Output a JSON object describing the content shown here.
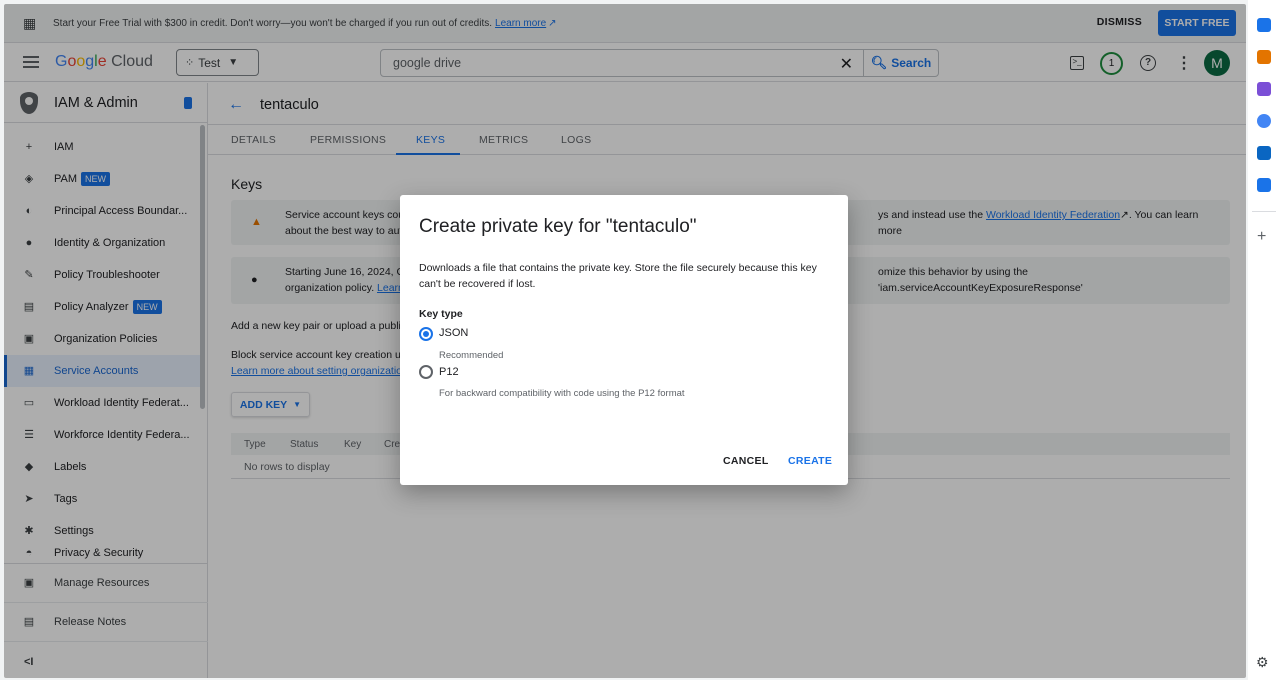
{
  "banner": {
    "text": "Start your Free Trial with $300 in credit. Don't worry—you won't be charged if you run out of credits.",
    "learn_more": "Learn more",
    "dismiss": "DISMISS",
    "start_free": "START FREE"
  },
  "header": {
    "logo_google": [
      "G",
      "o",
      "o",
      "g",
      "l",
      "e"
    ],
    "logo_cloud": "Cloud",
    "project": "Test",
    "search_value": "google drive",
    "search_button": "Search",
    "notifications_count": "1",
    "avatar_letter": "M"
  },
  "sidebar": {
    "title": "IAM & Admin",
    "items": [
      {
        "label": "IAM",
        "icon": "person-add-icon",
        "glyph": "+"
      },
      {
        "label": "PAM",
        "badge": "NEW",
        "icon": "shield-icon",
        "glyph": "◈"
      },
      {
        "label": "Principal Access Boundar...",
        "icon": "policy-icon",
        "glyph": "◐"
      },
      {
        "label": "Identity & Organization",
        "icon": "account-circle-icon",
        "glyph": "●"
      },
      {
        "label": "Policy Troubleshooter",
        "icon": "wrench-icon",
        "glyph": "✎"
      },
      {
        "label": "Policy Analyzer",
        "badge": "NEW",
        "icon": "document-search-icon",
        "glyph": "▤"
      },
      {
        "label": "Organization Policies",
        "icon": "list-box-icon",
        "glyph": "▣"
      },
      {
        "label": "Service Accounts",
        "icon": "service-account-icon",
        "glyph": "▦",
        "active": true
      },
      {
        "label": "Workload Identity Federat...",
        "icon": "id-card-icon",
        "glyph": "▭"
      },
      {
        "label": "Workforce Identity Federa...",
        "icon": "list-icon",
        "glyph": "☰"
      },
      {
        "label": "Labels",
        "icon": "label-icon",
        "glyph": "◆"
      },
      {
        "label": "Tags",
        "icon": "tag-icon",
        "glyph": "➤"
      },
      {
        "label": "Settings",
        "icon": "settings-icon",
        "glyph": "✱"
      },
      {
        "label": "Privacy & Security",
        "icon": "privacy-icon",
        "glyph": "◓"
      }
    ],
    "bottom": [
      {
        "label": "Manage Resources",
        "icon": "manage-resources-icon",
        "glyph": "▣"
      },
      {
        "label": "Release Notes",
        "icon": "release-notes-icon",
        "glyph": "▤"
      }
    ]
  },
  "main": {
    "title": "tentaculo",
    "tabs": [
      "DETAILS",
      "PERMISSIONS",
      "KEYS",
      "METRICS",
      "LOGS"
    ],
    "active_tab": "KEYS",
    "keys_heading": "Keys",
    "warning_left": "Service account keys cou",
    "warning_left_2": "about the best way to auth",
    "warning_right": "ys and instead use the",
    "warning_link": "Workload Identity Federation",
    "warning_right_2": ". You can learn more",
    "info_left": "Starting June 16, 2024, Go",
    "info_left_2": "organization policy.",
    "info_link": "Learn",
    "info_right": "omize this behavior by using the 'iam.serviceAccountKeyExposureResponse'",
    "add_text": "Add a new key pair or upload a public",
    "block_text": "Block service account key creation us",
    "block_link": "Learn more about setting organization",
    "add_key": "ADD KEY",
    "columns": [
      "Type",
      "Status",
      "Key",
      "Crea"
    ],
    "no_rows": "No rows to display"
  },
  "dialog": {
    "title": "Create private key for \"tentaculo\"",
    "description": "Downloads a file that contains the private key. Store the file securely because this key can't be recovered if lost.",
    "key_type_label": "Key type",
    "options": [
      {
        "label": "JSON",
        "sub": "Recommended",
        "checked": true
      },
      {
        "label": "P12",
        "sub": "For backward compatibility with code using the P12 format",
        "checked": false
      }
    ],
    "cancel": "CANCEL",
    "create": "CREATE"
  },
  "rail": {
    "colors": [
      "#1a73e8",
      "#e37400",
      "#7b4fd6",
      "#4285f4",
      "#0a66c2",
      "#1a73e8"
    ],
    "icons": [
      "tag-icon",
      "briefcase-icon",
      "people-icon",
      "copilot-icon",
      "outlook-icon",
      "send-icon"
    ]
  }
}
